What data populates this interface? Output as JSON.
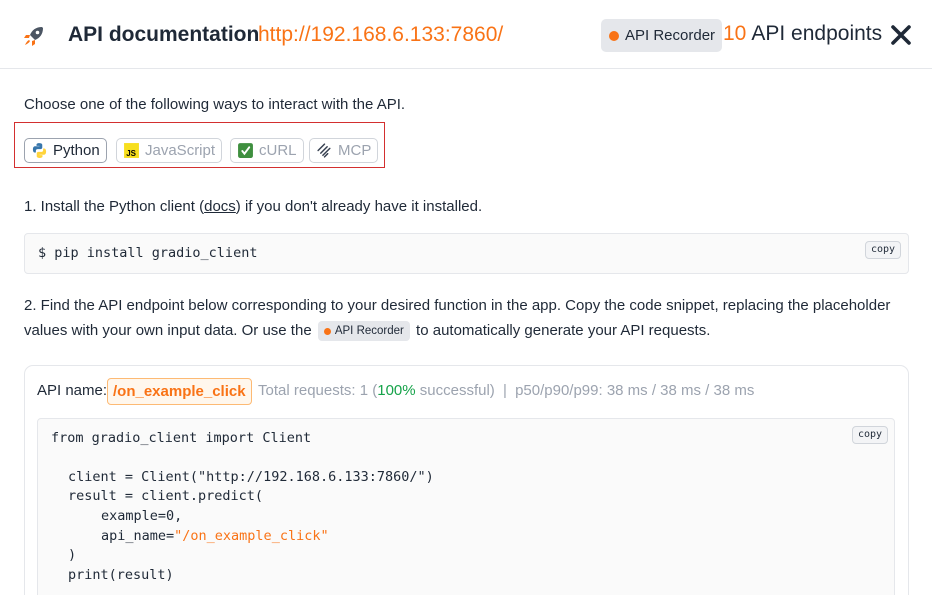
{
  "header": {
    "title": "API documentation",
    "url": "http://192.168.6.133:7860/",
    "recorder_label": "API Recorder",
    "endpoint_count": "10",
    "endpoint_label": "API endpoints"
  },
  "intro": "Choose one of the following ways to interact with the API.",
  "languages": [
    {
      "label": "Python",
      "active": true
    },
    {
      "label": "JavaScript",
      "active": false
    },
    {
      "label": "cURL",
      "active": false
    },
    {
      "label": "MCP",
      "active": false
    }
  ],
  "step1": {
    "prefix": "1. Install the Python client (",
    "link": "docs",
    "suffix": ") if you don't already have it installed."
  },
  "install_cmd": "$ pip install gradio_client",
  "copy_label": "copy",
  "step2": {
    "text_a": "2. Find the API endpoint below corresponding to your desired function in the app. Copy the code snippet, replacing the placeholder values with your own input data. Or use the",
    "recorder_label": "API Recorder",
    "text_b": "to automatically generate your API requests."
  },
  "endpoint": {
    "label": "API name:",
    "name": "/on_example_click",
    "stats_prefix": "Total requests: 1 (",
    "success_pct": "100%",
    "stats_mid": " successful)",
    "separator": "|",
    "latency": "p50/p90/p99: 38 ms / 38 ms / 38 ms"
  },
  "code": {
    "line1": "from gradio_client import Client",
    "line2": "client = Client(\"http://192.168.6.133:7860/\")",
    "line3": "result = client.predict(",
    "line4": "example=0,",
    "line5_prefix": "api_name=",
    "line5_value": "\"/on_example_click\"",
    "line6": ")",
    "line7": "print(result)"
  },
  "colors": {
    "accent": "#f97316",
    "success": "#16a34a",
    "highlight_border": "#d32f2f"
  }
}
